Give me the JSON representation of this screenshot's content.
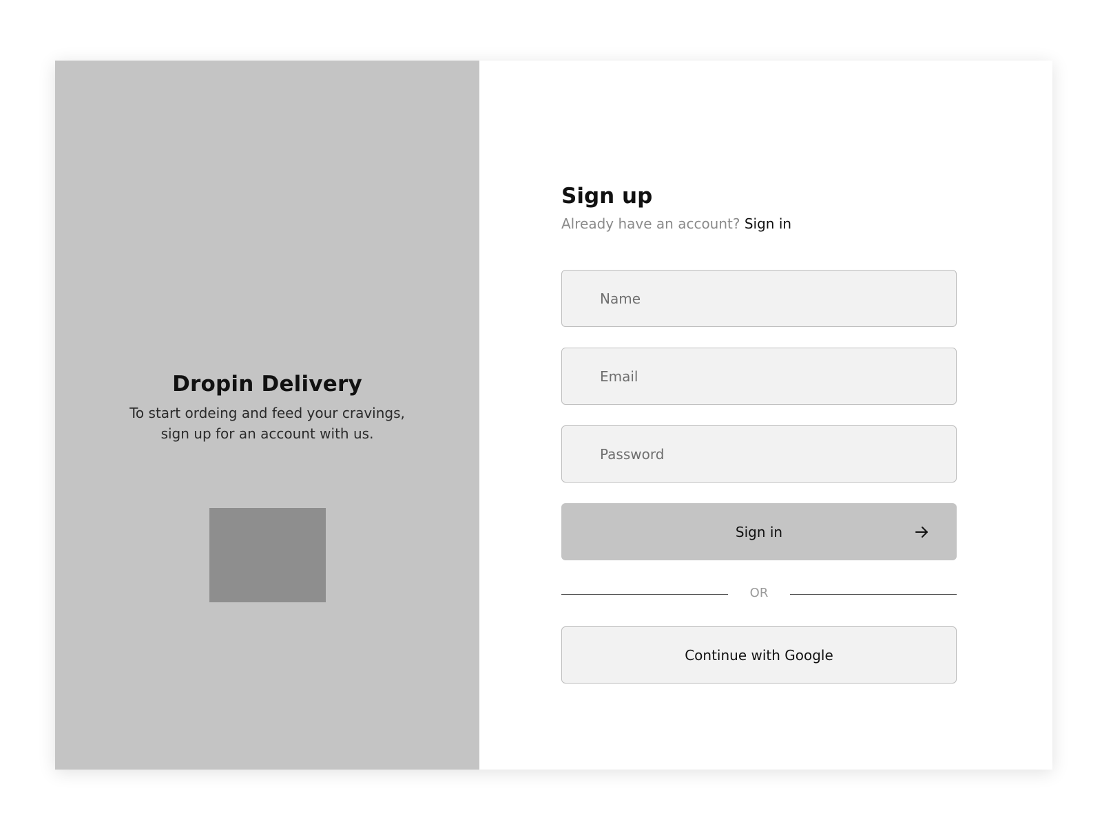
{
  "brand": {
    "title": "Dropin Delivery",
    "subtitle_line1": "To start ordeing and feed your cravings,",
    "subtitle_line2": "sign up for an account with us."
  },
  "form": {
    "title": "Sign up",
    "prompt": "Already have an account?",
    "signin_link": "Sign in",
    "name_placeholder": "Name",
    "email_placeholder": "Email",
    "password_placeholder": "Password",
    "submit_label": "Sign in",
    "submit_icon": "arrow-right-icon",
    "divider_text": "OR",
    "google_label": "Continue with Google"
  },
  "colors": {
    "left_panel_bg": "#c4c4c4",
    "illustration_placeholder": "#8e8e8e",
    "input_bg": "#f2f2f2",
    "button_bg": "#c4c4c4"
  }
}
